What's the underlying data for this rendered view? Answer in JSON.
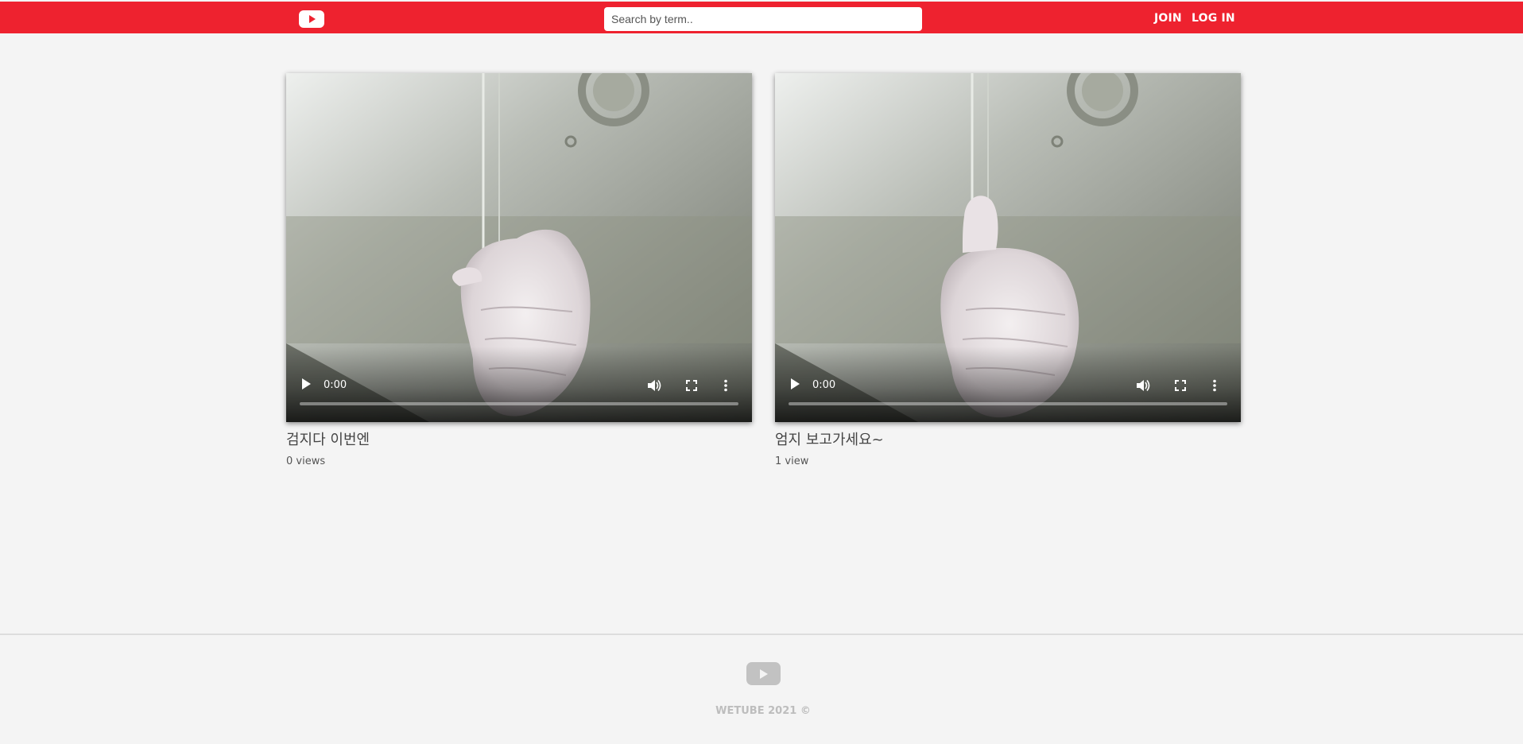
{
  "header": {
    "logo_icon": "youtube-logo-icon",
    "search_placeholder": "Search by term..",
    "join_label": "JOIN",
    "login_label": "LOG IN",
    "bg_color": "#ee222f"
  },
  "videos": [
    {
      "title": "검지다 이번엔",
      "views": "0 views",
      "time": "0:00",
      "progress": 0
    },
    {
      "title": "엄지 보고가세요~",
      "views": "1 view",
      "time": "0:00",
      "progress": 0
    }
  ],
  "footer": {
    "logo_icon": "youtube-logo-icon",
    "copyright": "WETUBE 2021 ©"
  }
}
